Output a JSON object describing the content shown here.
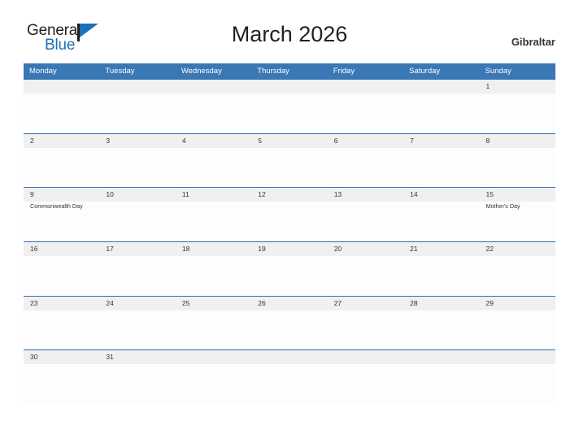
{
  "brand": {
    "word_one": "General",
    "word_two": "Blue",
    "flag_icon": "flag-icon"
  },
  "header": {
    "title": "March 2026",
    "region": "Gibraltar"
  },
  "calendar": {
    "weekdays": [
      "Monday",
      "Tuesday",
      "Wednesday",
      "Thursday",
      "Friday",
      "Saturday",
      "Sunday"
    ],
    "header_bg": "#3a77b5",
    "row_separator": "#2f6fb0",
    "date_band_bg": "#f0f0f0",
    "weeks": [
      [
        {
          "date": "",
          "event": ""
        },
        {
          "date": "",
          "event": ""
        },
        {
          "date": "",
          "event": ""
        },
        {
          "date": "",
          "event": ""
        },
        {
          "date": "",
          "event": ""
        },
        {
          "date": "",
          "event": ""
        },
        {
          "date": "1",
          "event": ""
        }
      ],
      [
        {
          "date": "2",
          "event": ""
        },
        {
          "date": "3",
          "event": ""
        },
        {
          "date": "4",
          "event": ""
        },
        {
          "date": "5",
          "event": ""
        },
        {
          "date": "6",
          "event": ""
        },
        {
          "date": "7",
          "event": ""
        },
        {
          "date": "8",
          "event": ""
        }
      ],
      [
        {
          "date": "9",
          "event": "Commonwealth Day"
        },
        {
          "date": "10",
          "event": ""
        },
        {
          "date": "11",
          "event": ""
        },
        {
          "date": "12",
          "event": ""
        },
        {
          "date": "13",
          "event": ""
        },
        {
          "date": "14",
          "event": ""
        },
        {
          "date": "15",
          "event": "Mother's Day"
        }
      ],
      [
        {
          "date": "16",
          "event": ""
        },
        {
          "date": "17",
          "event": ""
        },
        {
          "date": "18",
          "event": ""
        },
        {
          "date": "19",
          "event": ""
        },
        {
          "date": "20",
          "event": ""
        },
        {
          "date": "21",
          "event": ""
        },
        {
          "date": "22",
          "event": ""
        }
      ],
      [
        {
          "date": "23",
          "event": ""
        },
        {
          "date": "24",
          "event": ""
        },
        {
          "date": "25",
          "event": ""
        },
        {
          "date": "26",
          "event": ""
        },
        {
          "date": "27",
          "event": ""
        },
        {
          "date": "28",
          "event": ""
        },
        {
          "date": "29",
          "event": ""
        }
      ],
      [
        {
          "date": "30",
          "event": ""
        },
        {
          "date": "31",
          "event": ""
        },
        {
          "date": "",
          "event": ""
        },
        {
          "date": "",
          "event": ""
        },
        {
          "date": "",
          "event": ""
        },
        {
          "date": "",
          "event": ""
        },
        {
          "date": "",
          "event": ""
        }
      ]
    ]
  }
}
